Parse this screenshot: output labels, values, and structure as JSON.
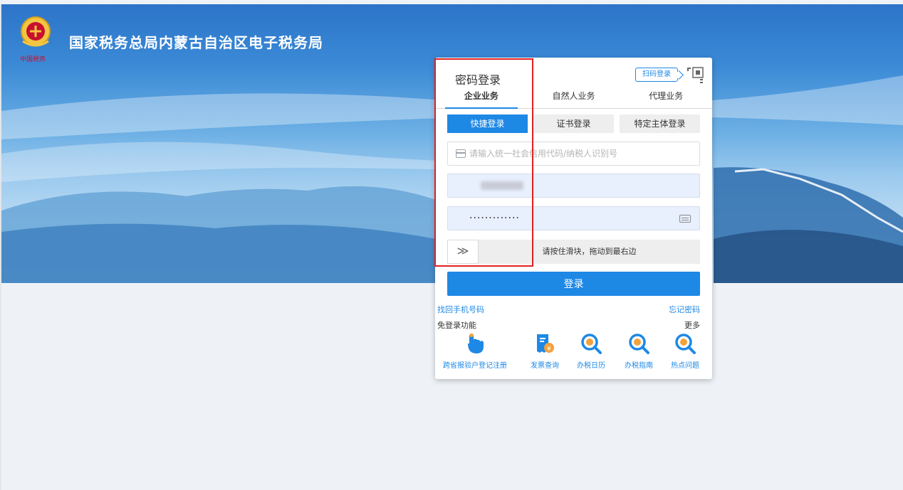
{
  "header": {
    "title": "国家税务总局内蒙古自治区电子税务局"
  },
  "login": {
    "title": "密码登录",
    "scan_label": "扫码登录",
    "biz_tabs": [
      "企业业务",
      "自然人业务",
      "代理业务"
    ],
    "login_tabs": [
      "快捷登录",
      "证书登录",
      "特定主体登录"
    ],
    "taxid_placeholder": "请输入统一社会信用代码/纳税人识别号",
    "password_mask": "·············",
    "slider_handle": "≫",
    "slider_text": "请按住滑块，拖动到最右边",
    "submit_label": "登录",
    "retrieve_phone": "找回手机号码",
    "forgot_password": "忘记密码"
  },
  "quick": {
    "title": "免登录功能",
    "more": "更多",
    "items": [
      {
        "label": "跨省报验户登记注册",
        "icon": "hand-pointer-icon"
      },
      {
        "label": "发票查询",
        "icon": "invoice-icon"
      },
      {
        "label": "办税日历",
        "icon": "search-magnifier-icon"
      },
      {
        "label": "办税指南",
        "icon": "search-magnifier-icon"
      },
      {
        "label": "热点问题",
        "icon": "search-magnifier-icon"
      }
    ]
  },
  "colors": {
    "primary": "#1e88e5",
    "highlight_box": "#e02020",
    "page_bg": "#eef2f6"
  }
}
